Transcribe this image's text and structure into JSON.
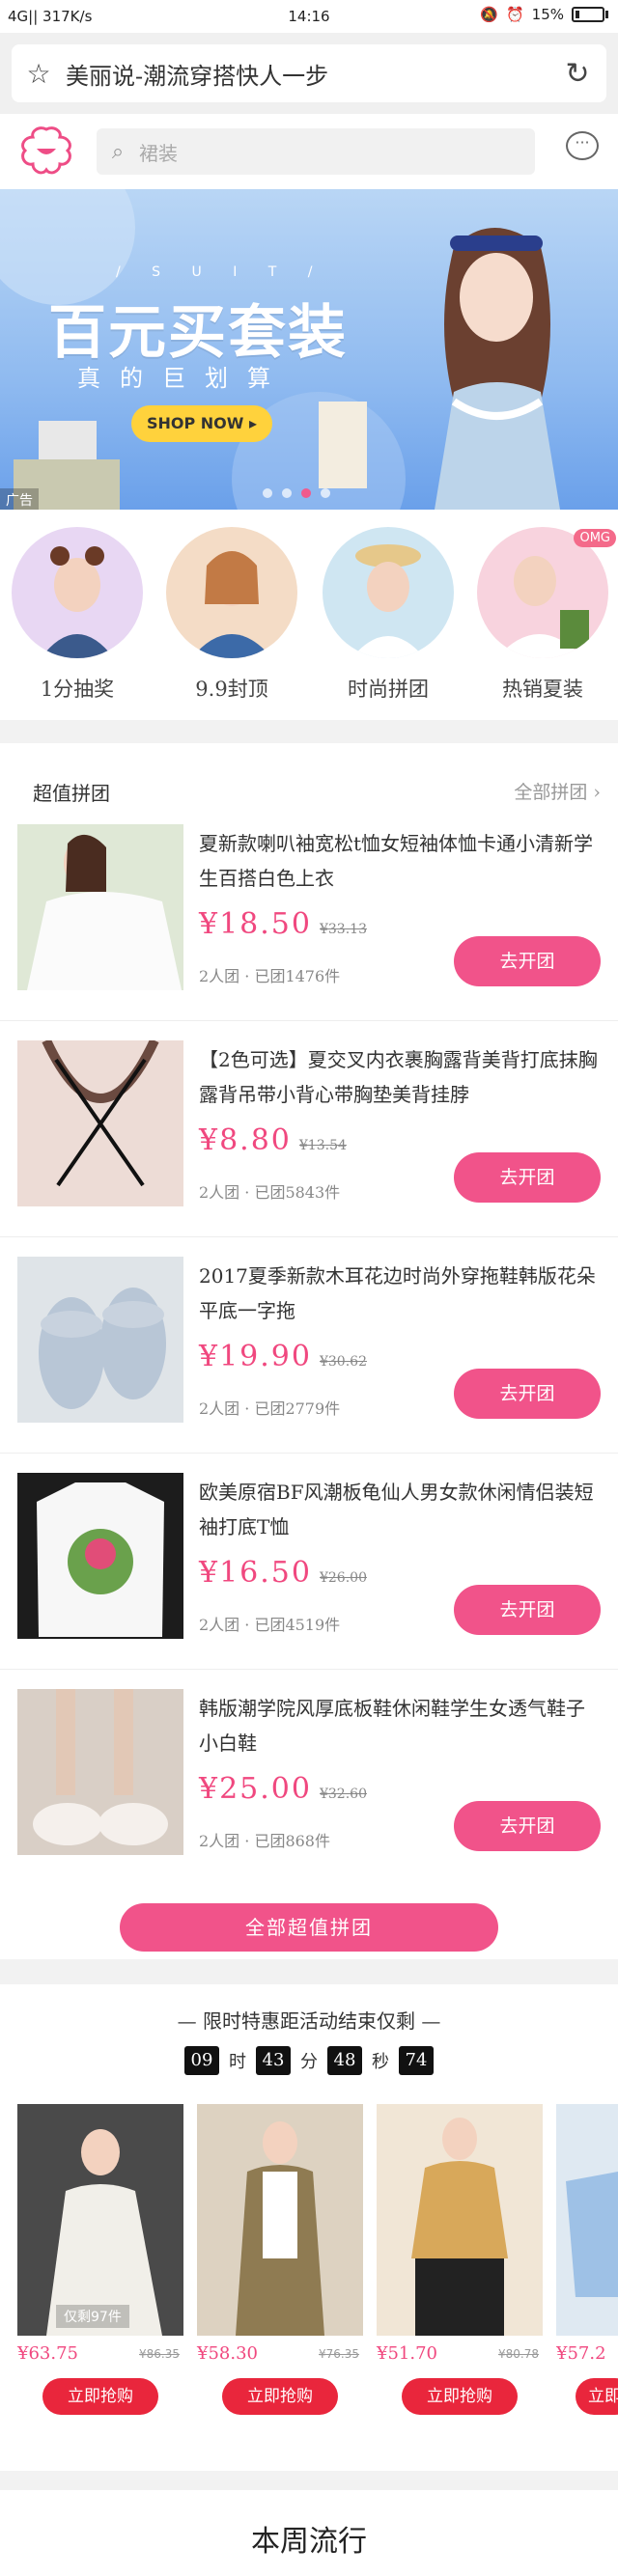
{
  "status_bar": {
    "signal": "4G|| 317K/s",
    "time": "14:16",
    "battery": "15%"
  },
  "browser": {
    "url_title": "美丽说-潮流穿搭快人一步"
  },
  "header": {
    "search_placeholder": "裙装"
  },
  "banner": {
    "suit_text": "/ S U I T /",
    "headline": "百元买套装",
    "subline": "真的巨划算",
    "shop_now": "SHOP NOW ▸",
    "ad_label": "广告"
  },
  "categories": [
    {
      "label": "1分抽奖"
    },
    {
      "label": "9.9封顶"
    },
    {
      "label": "时尚拼团"
    },
    {
      "label": "热销夏装",
      "badge": "OMG"
    }
  ],
  "group_section": {
    "title": "超值拼团",
    "more": "全部拼团 ›",
    "all_button": "全部超值拼团",
    "items": [
      {
        "name": "夏新款喇叭袖宽松t恤女短袖体恤卡通小清新学生百搭白色上衣",
        "price": "¥18.50",
        "orig": "¥33.13",
        "meta": "2人团 · 已团1476件",
        "btn": "去开团"
      },
      {
        "name": "【2色可选】夏交叉内衣裹胸露背美背打底抹胸露背吊带小背心带胸垫美背挂脖",
        "price": "¥8.80",
        "orig": "¥13.54",
        "meta": "2人团 · 已团5843件",
        "btn": "去开团"
      },
      {
        "name": "2017夏季新款木耳花边时尚外穿拖鞋韩版花朵平底一字拖",
        "price": "¥19.90",
        "orig": "¥30.62",
        "meta": "2人团 · 已团2779件",
        "btn": "去开团"
      },
      {
        "name": "欧美原宿BF风潮板龟仙人男女款休闲情侣装短袖打底T恤",
        "price": "¥16.50",
        "orig": "¥26.00",
        "meta": "2人团 · 已团4519件",
        "btn": "去开团"
      },
      {
        "name": "韩版潮学院风厚底板鞋休闲鞋学生女透气鞋子小白鞋",
        "price": "¥25.00",
        "orig": "¥32.60",
        "meta": "2人团 · 已团868件",
        "btn": "去开团"
      }
    ]
  },
  "flash_sale": {
    "title": "— 限时特惠距活动结束仅剩 —",
    "countdown": {
      "h": "09",
      "h_unit": "时",
      "m": "43",
      "m_unit": "分",
      "s": "48",
      "s_unit": "秒",
      "ms": "74"
    },
    "deals": [
      {
        "price": "¥63.75",
        "orig": "¥86.35",
        "stock": "仅剩97件",
        "btn": "立即抢购"
      },
      {
        "price": "¥58.30",
        "orig": "¥76.35",
        "stock": "",
        "btn": "立即抢购"
      },
      {
        "price": "¥51.70",
        "orig": "¥80.78",
        "stock": "",
        "btn": "立即抢购"
      },
      {
        "price": "¥57.2",
        "orig": "",
        "stock": "",
        "btn": "立即"
      }
    ]
  },
  "weekly": {
    "title": "本周流行"
  },
  "colors": {
    "accent": "#f1538a",
    "buy_red": "#e9263c"
  }
}
